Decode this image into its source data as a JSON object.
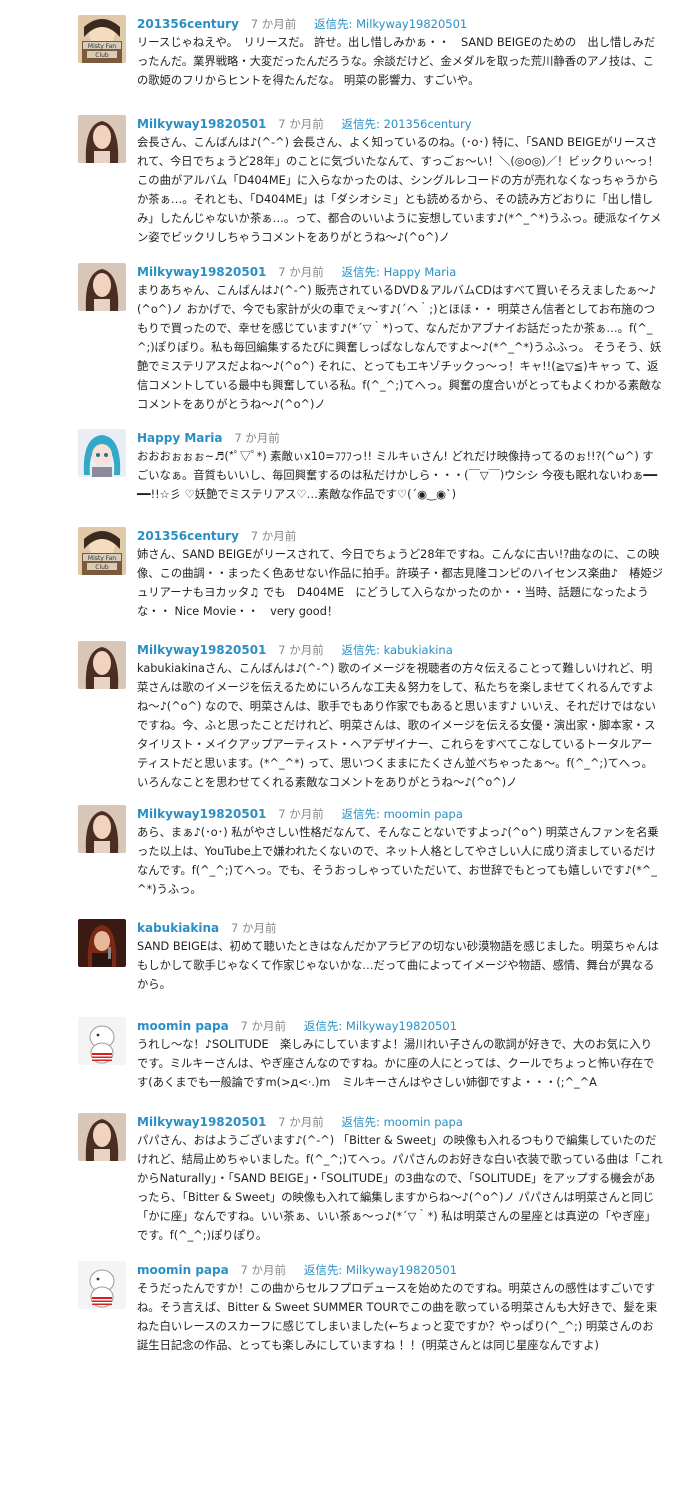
{
  "comments": [
    {
      "author": "201356century",
      "time": "7 か月前",
      "reply_label": "返信先:",
      "reply_to": "Milkyway19820501",
      "avatar": "misty-fan-club-avatar",
      "text": "リースじゃねえや。　リリースだ。 許せ。出し惜しみかぁ・・　SAND BEIGEのための　出し惜しみだったんだ。業界戦略・大変だったんだろうな。余談だけど、金メダルを取った荒川静香のアノ技は、この歌姫のフリからヒントを得たんだな。 明菜の影響力、すごいや。"
    },
    {
      "author": "Milkyway19820501",
      "time": "7 か月前",
      "reply_label": "返信先:",
      "reply_to": "201356century",
      "avatar": "woman-portrait-avatar",
      "text": "会長さん、こんばんは♪(^-^) 会長さん、よく知っているのね。(･o･) 特に、「SAND BEIGEがリースされて、今日でちょうど28年」のことに気づいたなんて、すっごぉ〜い！＼(◎o◎)／！ビックりぃ〜っ！ この曲がアルバム「D404ME」に入らなかったのは、シングルレコードの方が売れなくなっちゃうからか茶ぁ…。それとも、「D404ME」は「ダシオシミ」とも読めるから、その読み方どおりに「出し惜しみ」したんじゃないか茶ぁ…。って、都合のいいように妄想しています♪(*^_^*)うふっ。硬派なイケメン姿でビックリしちゃうコメントをありがとうね〜♪(^o^)ノ"
    },
    {
      "author": "Milkyway19820501",
      "time": "7 か月前",
      "reply_label": "返信先:",
      "reply_to": "Happy Maria",
      "avatar": "woman-portrait-avatar",
      "text": "まりあちゃん、こんばんは♪(^-^) 販売されているDVD＆アルバムCDはすべて買いそろえましたぁ〜♪(^o^)ノ おかげで、今でも家計が火の車でぇ〜す♪(´ヘ｀;)とほほ・・ 明菜さん信者としてお布施のつもりで買ったので、幸せを感じています♪(*´▽｀*)って、なんだかアブナイお話だったか茶ぁ…。f(^_^;)ぽりぽり。私も毎回編集するたびに興奮しっぱなしなんですよ〜♪(*^_^*)うふふっ。 そうそう、妖艶でミステリアスだよね〜♪(^o^) それに、とってもエキゾチックっ〜っ！キャ!!(≧▽≦)キャっ て、返信コメントしている最中も興奮している私。f(^_^;)てへっ。興奮の度合いがとってもよくわかる素敵なコメントをありがとうね〜♪(^o^)ノ"
    },
    {
      "author": "Happy Maria",
      "time": "7 か月前",
      "reply_label": "",
      "reply_to": "",
      "avatar": "anime-girl-avatar",
      "text": "おおおぉぉぉ~♬(*ﾟ▽ﾟ*) 素敵ぃx10=ﾌﾌﾌっ!! ミルキぃさん! どれだけ映像持ってるのぉ!!?(^ω^) すごいなぁ。音質もいいし、毎回興奮するのは私だけかしら・・・(￣▽￣)ウシシ 今夜も眠れないわぁ━━━━!!☆彡 ♡妖艶でミステリアス♡…素敵な作品です♡(´◉‿◉`)"
    },
    {
      "author": "201356century",
      "time": "7 か月前",
      "reply_label": "",
      "reply_to": "",
      "avatar": "misty-fan-club-avatar",
      "text": "姉さん、SAND BEIGEがリースされて、今日でちょうど28年ですね。こんなに古い!?曲なのに、この映像、この曲調・・まったく色あせない作品に拍手。許瑛子・都志見隆コンビのハイセンス楽曲♪　椿姫ジュリアーナもヨカッタ♫ でも　D404ME　にどうして入らなかったのか・・当時、話題になったような・・ Nice Movie・・　very good！"
    },
    {
      "author": "Milkyway19820501",
      "time": "7 か月前",
      "reply_label": "返信先:",
      "reply_to": "kabukiakina",
      "avatar": "woman-portrait-avatar",
      "text": "kabukiakinaさん、こんばんは♪(^-^) 歌のイメージを視聴者の方々伝えることって難しいけれど、明菜さんは歌のイメージを伝えるためにいろんな工夫＆努力をして、私たちを楽しませてくれるんですよね〜♪(^o^) なので、明菜さんは、歌手でもあり作家でもあると思います♪ いいえ、それだけではないですね。今、ふと思ったことだけれど、明菜さんは、歌のイメージを伝える女優・演出家・脚本家・スタイリスト・メイクアップアーティスト・ヘアデザイナー、これらをすべてこなしているトータルアーティストだと思います。(*^_^*) って、思いつくままにたくさん並べちゃったぁ〜。f(^_^;)てへっ。いろんなことを思わせてくれる素敵なコメントをありがとうね〜♪(^o^)ノ"
    },
    {
      "author": "Milkyway19820501",
      "time": "7 か月前",
      "reply_label": "返信先:",
      "reply_to": "moomin papa",
      "avatar": "woman-portrait-avatar",
      "text": "あら、まぁ♪(･o･) 私がやさしい性格だなんて、そんなことないですよっ♪(^o^) 明菜さんファンを名乗った以上は、YouTube上で嫌われたくないので、ネット人格としてやさしい人に成り済ましているだけなんです。f(^_^;)てへっ。でも、そうおっしゃっていただいて、お世辞でもとっても嬉しいです♪(*^_^*)うふっ。"
    },
    {
      "author": "kabukiakina",
      "time": "7 か月前",
      "reply_label": "",
      "reply_to": "",
      "avatar": "singer-photo-avatar",
      "text": "SAND BEIGEは、初めて聴いたときはなんだかアラビアの切ない砂漠物語を感じました。明菜ちゃんはもしかして歌手じゃなくて作家じゃないかな…だって曲によってイメージや物語、感情、舞台が異なるから。"
    },
    {
      "author": "moomin papa",
      "time": "7 か月前",
      "reply_label": "返信先:",
      "reply_to": "Milkyway19820501",
      "avatar": "moomin-avatar",
      "text": "うれし〜な！♪SOLITUDE　楽しみにしていますよ！湯川れい子さんの歌詞が好きで、大のお気に入りです。ミルキーさんは、やぎ座さんなのですね。かに座の人にとっては、クールでちょっと怖い存在です(あくまでも一般論ですm(>д<·.)m　ミルキーさんはやさしい姉御ですよ・・・(;^_^A"
    },
    {
      "author": "Milkyway19820501",
      "time": "7 か月前",
      "reply_label": "返信先:",
      "reply_to": "moomin papa",
      "avatar": "woman-portrait-avatar",
      "text": "パパさん、おはようございます♪(^-^) 「Bitter & Sweet」の映像も入れるつもりで編集していたのだけれど、結局止めちゃいました。f(^_^;)てへっ。パパさんのお好きな白い衣装で歌っている曲は「これからNaturally」・「SAND BEIGE」・「SOLITUDE」の3曲なので、「SOLITUDE」をアップする機会があったら、「Bitter & Sweet」の映像も入れて編集しますからね〜♪(^o^)ノ パパさんは明菜さんと同じ「かに座」なんですね。いい茶ぁ、いい茶ぁ〜っ♪(*´▽｀*) 私は明菜さんの星座とは真逆の「やぎ座」です。f(^_^;)ぽりぽり。"
    },
    {
      "author": "moomin papa",
      "time": "7 か月前",
      "reply_label": "返信先:",
      "reply_to": "Milkyway19820501",
      "avatar": "moomin-avatar",
      "text": "そうだったんですか！この曲からセルフプロデュースを始めたのですね。明菜さんの感性はすごいですね。そう言えば、Bitter & Sweet SUMMER TOURでこの曲を歌っている明菜さんも大好きで、髪を束ねた白いレースのスカーフに感じてしまいました(←ちょっと変ですか？やっぱり(^_^;) 明菜さんのお誕生日記念の作品、とっても楽しみにしていますね ！！(明菜さんとは同じ星座なんですよ)"
    }
  ]
}
